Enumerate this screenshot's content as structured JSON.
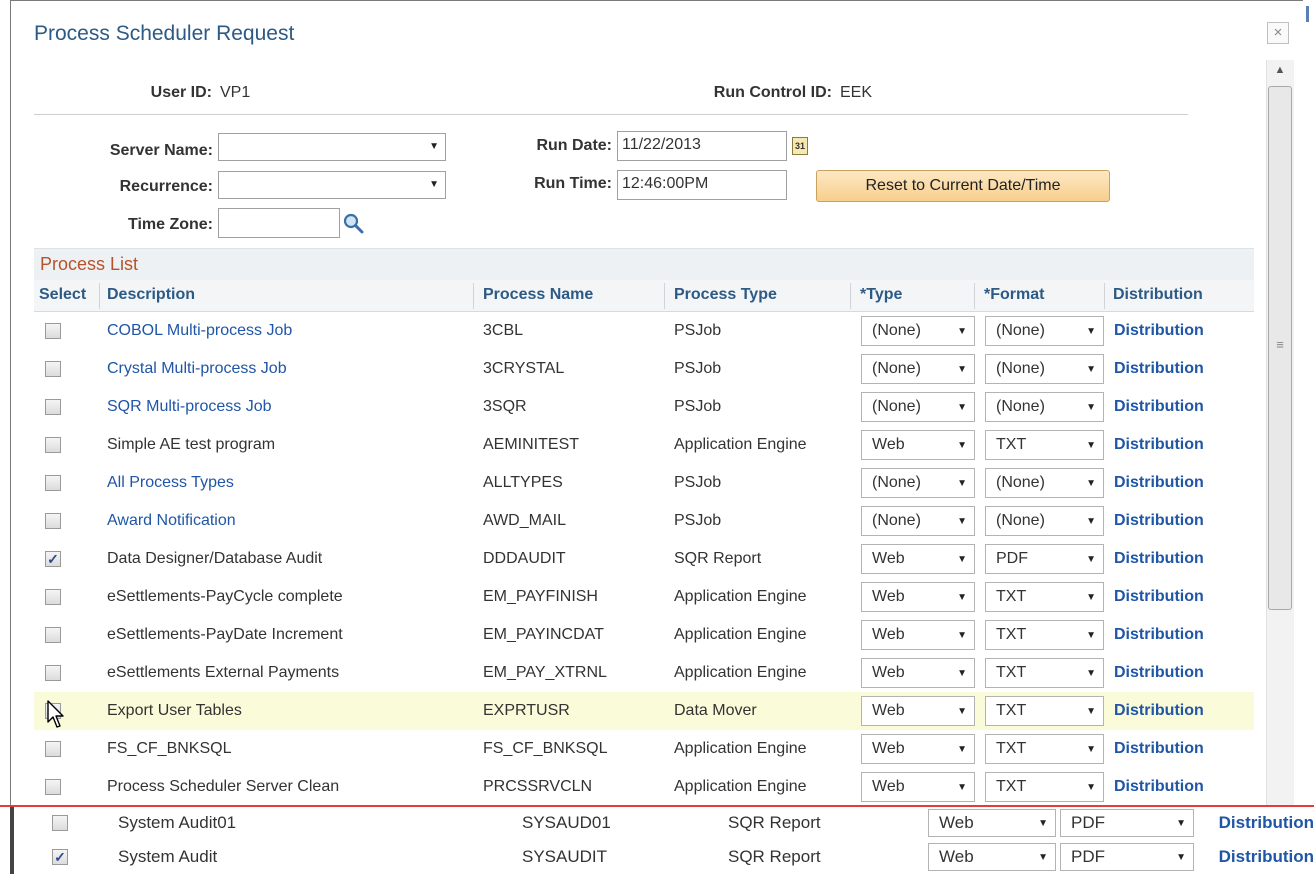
{
  "dialog": {
    "title": "Process Scheduler Request",
    "close_label": "×"
  },
  "header": {
    "user_id_label": "User ID:",
    "user_id_value": "VP1",
    "run_control_label": "Run Control ID:",
    "run_control_value": "EEK"
  },
  "form": {
    "server_name_label": "Server Name:",
    "server_name_value": "",
    "recurrence_label": "Recurrence:",
    "recurrence_value": "",
    "time_zone_label": "Time Zone:",
    "time_zone_value": "",
    "run_date_label": "Run Date:",
    "run_date_value": "11/22/2013",
    "calendar_icon_text": "31",
    "run_time_label": "Run Time:",
    "run_time_value": "12:46:00PM",
    "reset_button": "Reset to Current Date/Time"
  },
  "process_list": {
    "title": "Process List",
    "headers": {
      "select": "Select",
      "description": "Description",
      "process_name": "Process Name",
      "process_type": "Process Type",
      "type": "*Type",
      "format": "*Format",
      "distribution": "Distribution"
    },
    "rows": [
      {
        "checked": false,
        "description": "COBOL Multi-process Job",
        "link": true,
        "process_name": "3CBL",
        "process_type": "PSJob",
        "type": "(None)",
        "format": "(None)",
        "distribution": "Distribution"
      },
      {
        "checked": false,
        "description": "Crystal Multi-process Job",
        "link": true,
        "process_name": "3CRYSTAL",
        "process_type": "PSJob",
        "type": "(None)",
        "format": "(None)",
        "distribution": "Distribution"
      },
      {
        "checked": false,
        "description": "SQR Multi-process Job",
        "link": true,
        "process_name": "3SQR",
        "process_type": "PSJob",
        "type": "(None)",
        "format": "(None)",
        "distribution": "Distribution"
      },
      {
        "checked": false,
        "description": "Simple AE test program",
        "link": false,
        "process_name": "AEMINITEST",
        "process_type": "Application Engine",
        "type": "Web",
        "format": "TXT",
        "distribution": "Distribution"
      },
      {
        "checked": false,
        "description": "All Process Types",
        "link": true,
        "process_name": "ALLTYPES",
        "process_type": "PSJob",
        "type": "(None)",
        "format": "(None)",
        "distribution": "Distribution"
      },
      {
        "checked": false,
        "description": "Award Notification",
        "link": true,
        "process_name": "AWD_MAIL",
        "process_type": "PSJob",
        "type": "(None)",
        "format": "(None)",
        "distribution": "Distribution"
      },
      {
        "checked": true,
        "description": "Data Designer/Database Audit",
        "link": false,
        "process_name": "DDDAUDIT",
        "process_type": "SQR Report",
        "type": "Web",
        "format": "PDF",
        "distribution": "Distribution"
      },
      {
        "checked": false,
        "description": "eSettlements-PayCycle complete",
        "link": false,
        "process_name": "EM_PAYFINISH",
        "process_type": "Application Engine",
        "type": "Web",
        "format": "TXT",
        "distribution": "Distribution"
      },
      {
        "checked": false,
        "description": "eSettlements-PayDate Increment",
        "link": false,
        "process_name": "EM_PAYINCDAT",
        "process_type": "Application Engine",
        "type": "Web",
        "format": "TXT",
        "distribution": "Distribution"
      },
      {
        "checked": false,
        "description": "eSettlements External Payments",
        "link": false,
        "process_name": "EM_PAY_XTRNL",
        "process_type": "Application Engine",
        "type": "Web",
        "format": "TXT",
        "distribution": "Distribution"
      },
      {
        "checked": false,
        "description": "Export User Tables",
        "link": false,
        "process_name": "EXPRTUSR",
        "process_type": "Data Mover",
        "type": "Web",
        "format": "TXT",
        "distribution": "Distribution"
      },
      {
        "checked": false,
        "description": "FS_CF_BNKSQL",
        "link": false,
        "process_name": "FS_CF_BNKSQL",
        "process_type": "Application Engine",
        "type": "Web",
        "format": "TXT",
        "distribution": "Distribution"
      },
      {
        "checked": false,
        "description": "Process Scheduler Server Clean",
        "link": false,
        "process_name": "PRCSSRVCLN",
        "process_type": "Application Engine",
        "type": "Web",
        "format": "TXT",
        "distribution": "Distribution"
      }
    ]
  },
  "bottom_rows": [
    {
      "checked": false,
      "description": "System Audit01",
      "process_name": "SYSAUD01",
      "process_type": "SQR Report",
      "type": "Web",
      "format": "PDF",
      "distribution": "Distribution"
    },
    {
      "checked": true,
      "description": "System Audit",
      "process_name": "SYSAUDIT",
      "process_type": "SQR Report",
      "type": "Web",
      "format": "PDF",
      "distribution": "Distribution"
    }
  ],
  "colors": {
    "title": "#2d5a85",
    "link": "#1f56a6",
    "section_title": "#b5532b",
    "highlight_row": "#fafbd9",
    "divider": "#e53b3b"
  }
}
